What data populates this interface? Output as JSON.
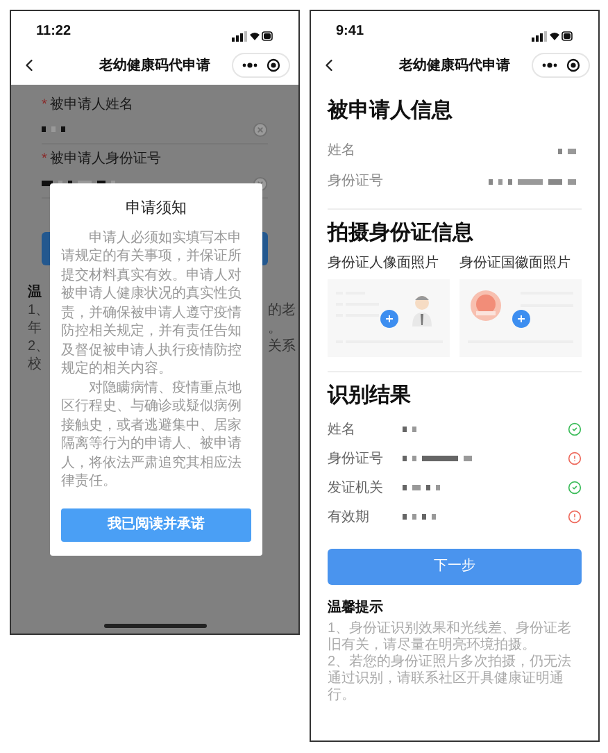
{
  "left_screen": {
    "status_bar": {
      "time": "11:22"
    },
    "nav": {
      "title": "老幼健康码代申请"
    },
    "form_fields": [
      {
        "required_mark": "*",
        "label": "被申请人姓名"
      },
      {
        "required_mark": "*",
        "label": "被申请人身份证号"
      }
    ],
    "hidden_tips": {
      "left_fragments": [
        "温",
        "1、",
        "年",
        "2、",
        "校"
      ],
      "right_fragments": [
        "的老",
        "。",
        "关系"
      ]
    },
    "dialog": {
      "title": "申请须知",
      "paragraphs": [
        "申请人必须如实填写本申请规定的有关事项，并保证所提交材料真实有效。申请人对被申请人健康状况的真实性负责，并确保被申请人遵守疫情防控相关规定，并有责任告知及督促被申请人执行疫情防控规定的相关内容。",
        "对隐瞒病情、疫情重点地区行程史、与确诊或疑似病例接触史，或者逃避集中、居家隔离等行为的申请人、被申请人，将依法严肃追究其相应法律责任。"
      ],
      "button": "我已阅读并承诺"
    }
  },
  "right_screen": {
    "status_bar": {
      "time": "9:41"
    },
    "nav": {
      "title": "老幼健康码代申请"
    },
    "applicant": {
      "title": "被申请人信息",
      "rows": [
        {
          "label": "姓名"
        },
        {
          "label": "身份证号"
        }
      ]
    },
    "photos": {
      "title": "拍摄身份证信息",
      "cards": [
        {
          "kind": "portrait",
          "label": "身份证人像面照片"
        },
        {
          "kind": "emblem",
          "label": "身份证国徽面照片"
        }
      ]
    },
    "results": {
      "title": "识别结果",
      "rows": [
        {
          "label": "姓名",
          "valid": true
        },
        {
          "label": "身份证号",
          "valid": false
        },
        {
          "label": "发证机关",
          "valid": true
        },
        {
          "label": "有效期",
          "valid": false
        }
      ]
    },
    "button": "下一步",
    "tips": {
      "title": "温馨提示",
      "items": [
        "1、身份证识别效果和光线差、身份证老旧有关，请尽量在明亮环境拍摄。",
        "2、若您的身份证照片多次拍摄，仍无法通过识别，请联系社区开具健康证明通行。"
      ]
    }
  }
}
